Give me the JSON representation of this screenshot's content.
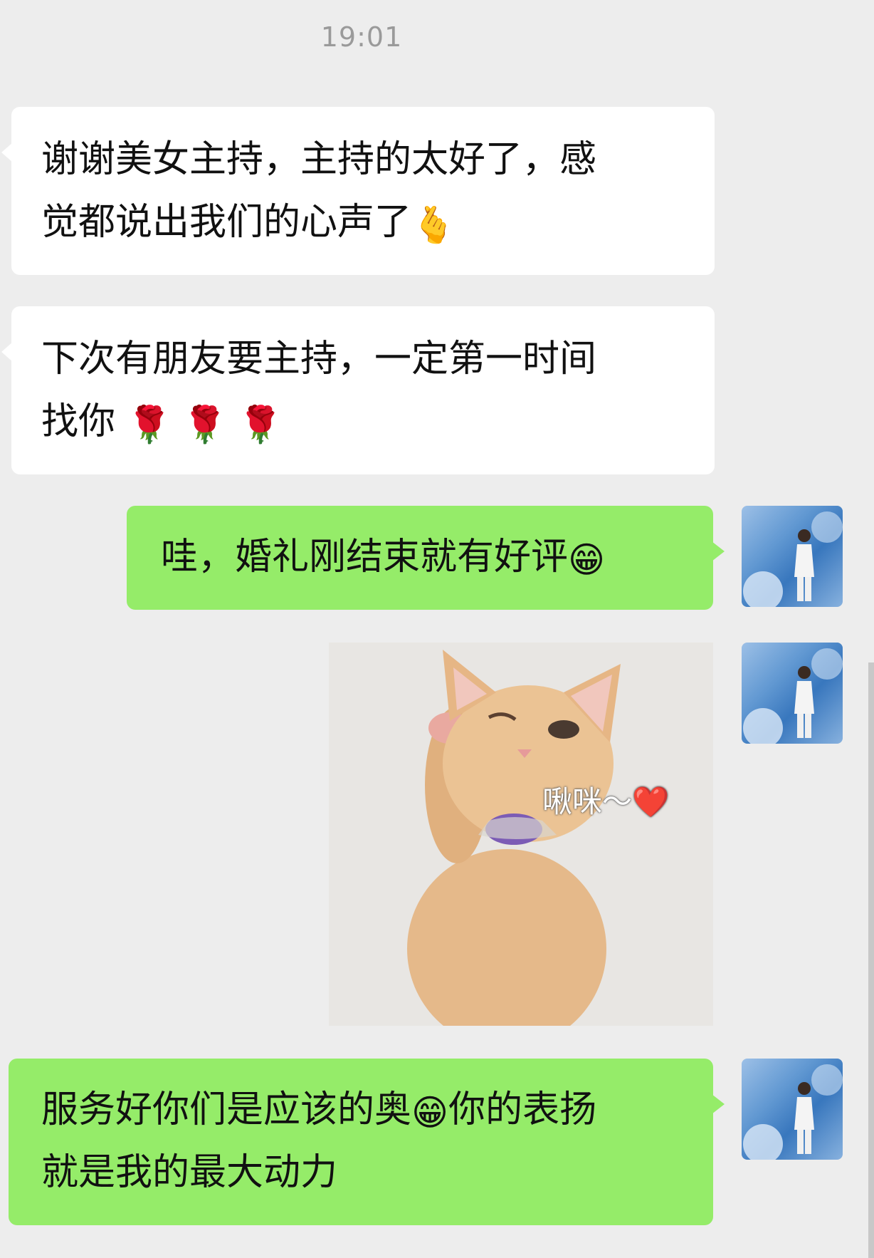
{
  "chat": {
    "timestamp": "19:01",
    "messages": [
      {
        "side": "left",
        "line1": "谢谢美女主持，主持的太好了，感",
        "line2": "觉都说出我们的心声了",
        "emoji": "🫰"
      },
      {
        "side": "left",
        "line1": "下次有朋友要主持，一定第一时间",
        "line2": "找你",
        "emoji": "🌹 🌹 🌹"
      },
      {
        "side": "right",
        "text": "哇，婚礼刚结束就有好评",
        "emoji": "😁"
      },
      {
        "side": "right",
        "type": "sticker",
        "caption": "啾咪～❤️"
      },
      {
        "side": "right",
        "line1_part1": "服务好你们是应该的奥",
        "line1_emoji": "😁",
        "line1_part2": "你的表扬",
        "line2": "就是我的最大动力"
      }
    ]
  },
  "icons": {
    "avatar": "avatar-icon",
    "sticker": "kitten-sticker"
  },
  "colors": {
    "background": "#ededed",
    "incoming_bubble": "#ffffff",
    "outgoing_bubble": "#95ec69",
    "timestamp": "#9a9a9a"
  }
}
